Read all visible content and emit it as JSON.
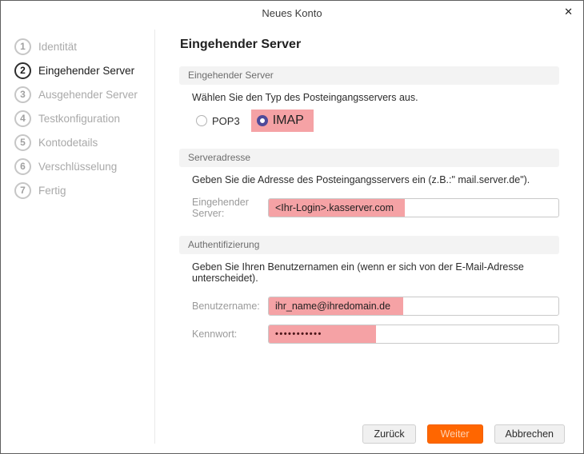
{
  "window": {
    "title": "Neues Konto",
    "close_icon": "✕"
  },
  "steps": [
    {
      "number": "1",
      "label": "Identität"
    },
    {
      "number": "2",
      "label": "Eingehender Server"
    },
    {
      "number": "3",
      "label": "Ausgehender Server"
    },
    {
      "number": "4",
      "label": "Testkonfiguration"
    },
    {
      "number": "5",
      "label": "Kontodetails"
    },
    {
      "number": "6",
      "label": "Verschlüsselung"
    },
    {
      "number": "7",
      "label": "Fertig"
    }
  ],
  "main": {
    "heading": "Eingehender Server",
    "server_type": {
      "section_title": "Eingehender Server",
      "description": "Wählen Sie den Typ des Posteingangsservers aus.",
      "options": [
        {
          "label": "POP3",
          "selected": false
        },
        {
          "label": "IMAP",
          "selected": true
        }
      ]
    },
    "server_address": {
      "section_title": "Serveradresse",
      "description": "Geben Sie die Adresse des Posteingangsservers ein (z.B.:\" mail.server.de\").",
      "field_label": "Eingehender Server:",
      "field_value": "<Ihr-Login>.kasserver.com"
    },
    "authentication": {
      "section_title": "Authentifizierung",
      "description": "Geben Sie Ihren Benutzernamen ein (wenn er sich von der E-Mail-Adresse unterscheidet).",
      "username_label": "Benutzername:",
      "username_value": "ihr_name@ihredomain.de",
      "password_label": "Kennwort:",
      "password_value": "•••••••••••"
    }
  },
  "footer": {
    "back_label": "Zurück",
    "next_label": "Weiter",
    "cancel_label": "Abbrechen"
  },
  "colors": {
    "highlight_pink": "#f5a2a5",
    "primary_orange": "#ff6600",
    "radio_selected": "#4f4a99"
  }
}
